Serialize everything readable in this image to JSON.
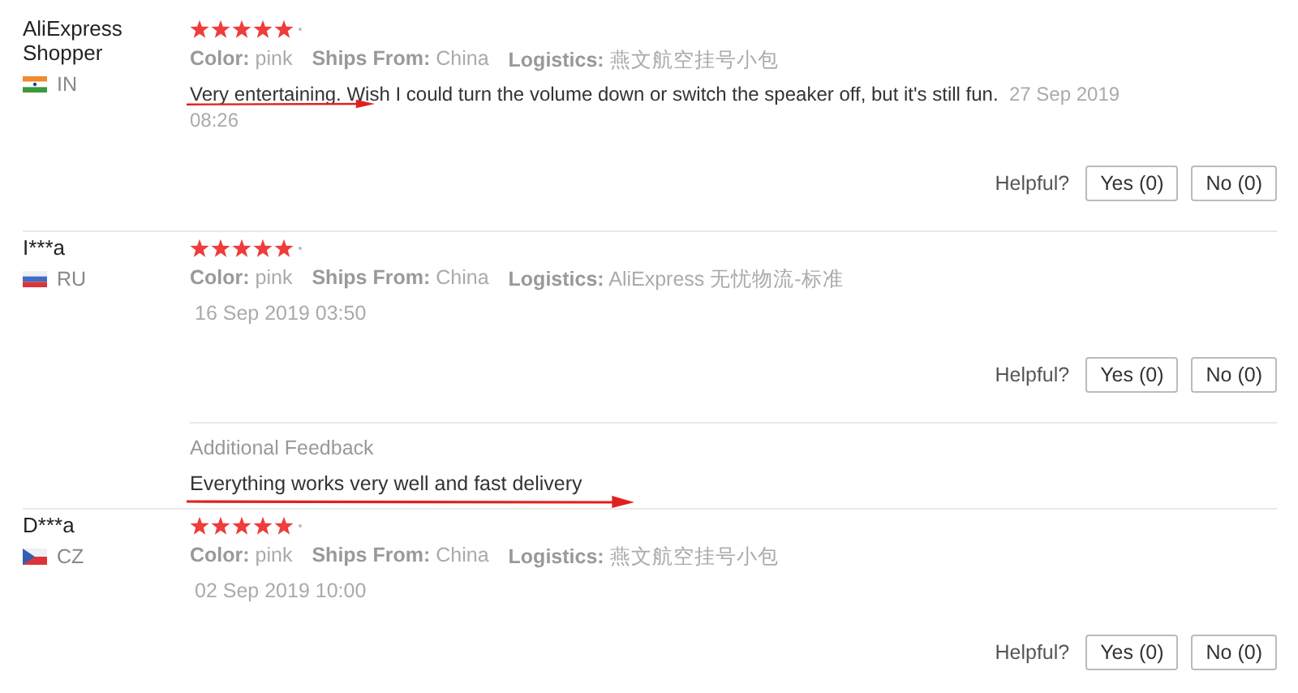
{
  "reviews": [
    {
      "name": "AliExpress Shopper",
      "flag": {
        "kind": "emblem"
      },
      "country": "IN",
      "stars": 5,
      "meta": [
        {
          "label": "Color:",
          "value": "pink"
        },
        {
          "label": "Ships From:",
          "value": "China"
        },
        {
          "label": "Logistics:",
          "value": "燕文航空挂号小包"
        }
      ],
      "comment": {
        "text": "Very entertaining. Wish I could turn the volume down or switch the speaker off, but it's still fun.",
        "annotated": true
      },
      "date": "27 Sep 2019 08:26",
      "helpful": {
        "label": "Helpful?",
        "yes": "Yes (0)",
        "no": "No (0)"
      }
    },
    {
      "name": "I***a",
      "flag": {
        "kind": "tricolor"
      },
      "country": "RU",
      "stars": 5,
      "meta": [
        {
          "label": "Color:",
          "value": "pink"
        },
        {
          "label": "Ships From:",
          "value": "China"
        },
        {
          "label": "Logistics:",
          "value": "AliExpress 无忧物流-标准"
        }
      ],
      "date": "16 Sep 2019 03:50",
      "helpful": {
        "label": "Helpful?",
        "yes": "Yes (0)",
        "no": "No (0)"
      },
      "additional": {
        "title": "Additional Feedback",
        "text": "Everything works very well and fast delivery",
        "annotated": true
      }
    },
    {
      "name": "D***a",
      "flag": {
        "kind": "wedge"
      },
      "country": "CZ",
      "stars": 5,
      "meta": [
        {
          "label": "Color:",
          "value": "pink"
        },
        {
          "label": "Ships From:",
          "value": "China"
        },
        {
          "label": "Logistics:",
          "value": "燕文航空挂号小包"
        }
      ],
      "date": "02 Sep 2019 10:00",
      "helpful": {
        "label": "Helpful?",
        "yes": "Yes (0)",
        "no": "No (0)"
      }
    }
  ]
}
